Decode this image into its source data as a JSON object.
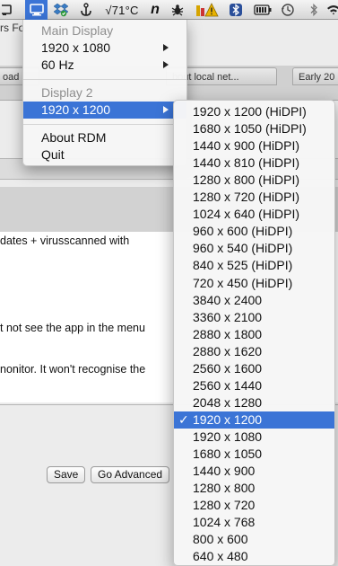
{
  "menubar": {
    "icons": [
      "display-icon",
      "dropbox-icon",
      "anchor-icon",
      "temperature-icon",
      "n-app-icon",
      "bug-icon",
      "warning-icon",
      "bluetooth-alt-icon",
      "battery-icon",
      "time-machine-icon",
      "bluetooth-icon",
      "wifi-icon"
    ],
    "temperature": "√71°C",
    "n_app_label": "n"
  },
  "background_app": {
    "site_title": "rs Fo",
    "tabs": [
      "oad",
      "bout local net...",
      "Early 20"
    ],
    "content_lines": [
      "dates + virusscanned with",
      "t not see the app in the menu",
      "nonitor. It won't recognise the",
      "."
    ],
    "save_button": "Save",
    "advanced_button": "Go Advanced"
  },
  "rdm_menu": {
    "main_display_header": "Main Display",
    "main_resolution": "1920 x 1080",
    "main_refresh": "60 Hz",
    "display2_header": "Display 2",
    "display2_resolution": "1920 x 1200",
    "about": "About RDM",
    "quit": "Quit"
  },
  "resolution_submenu": {
    "items": [
      "1920 x 1200 (HiDPI)",
      "1680 x 1050 (HiDPI)",
      "1440 x 900 (HiDPI)",
      "1440 x 810 (HiDPI)",
      "1280 x 800 (HiDPI)",
      "1280 x 720 (HiDPI)",
      "1024 x 640 (HiDPI)",
      "960 x 600 (HiDPI)",
      "960 x 540 (HiDPI)",
      "840 x 525 (HiDPI)",
      "720 x 450 (HiDPI)",
      "3840 x 2400",
      "3360 x 2100",
      "2880 x 1800",
      "2880 x 1620",
      "2560 x 1600",
      "2560 x 1440",
      "2048 x 1280",
      "1920 x 1200",
      "1920 x 1080",
      "1680 x 1050",
      "1440 x 900",
      "1280 x 800",
      "1280 x 720",
      "1024 x 768",
      "800 x 600",
      "640 x 480"
    ],
    "selected": "1920 x 1200",
    "check_mark": "✓"
  },
  "colors": {
    "selection": "#3b74d6",
    "menu_background": "#f6f6f6",
    "disabled_text": "#8e8e8e"
  }
}
